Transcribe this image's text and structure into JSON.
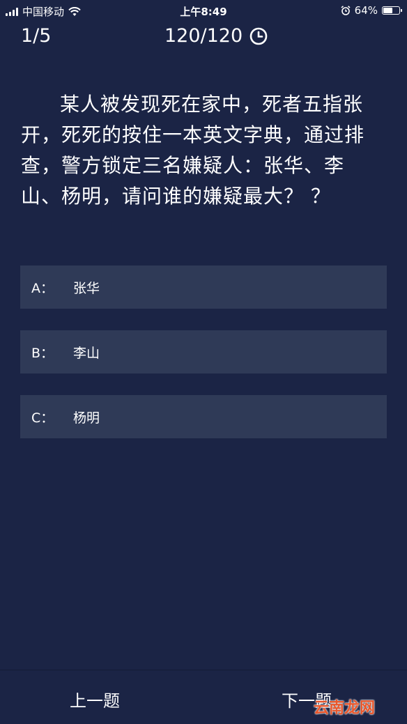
{
  "status_bar": {
    "carrier": "中国移动",
    "time": "上午8:49",
    "battery_percent": "64%",
    "battery_level": 0.64
  },
  "quiz": {
    "progress": "1/5",
    "timer": "120/120"
  },
  "question": {
    "text": "某人被发现死在家中，死者五指张开，死死的按住一本英文字典，通过排查，警方锁定三名嫌疑人：张华、李山、杨明，请问谁的嫌疑最大？ ？"
  },
  "options": [
    {
      "key": "A：",
      "label": "张华"
    },
    {
      "key": "B：",
      "label": "李山"
    },
    {
      "key": "C：",
      "label": "杨明"
    }
  ],
  "nav": {
    "prev": "上一题",
    "next": "下一题"
  },
  "watermark": "云南龙网"
}
